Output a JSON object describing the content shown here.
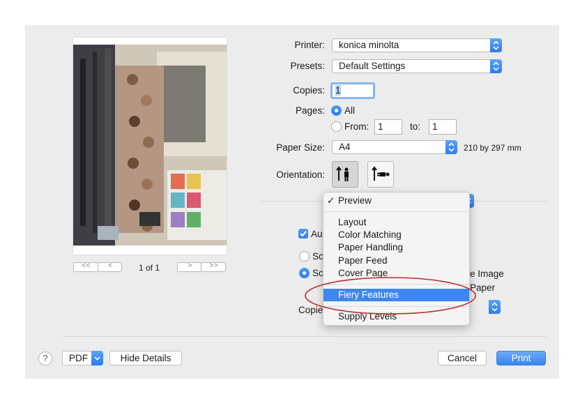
{
  "printer": {
    "label": "Printer:",
    "value": "konica minolta"
  },
  "presets": {
    "label": "Presets:",
    "value": "Default Settings"
  },
  "copies": {
    "label": "Copies:",
    "value": "1"
  },
  "pages": {
    "label": "Pages:",
    "all": "All",
    "from_label": "From:",
    "from_value": "1",
    "to_label": "to:",
    "to_value": "1"
  },
  "paper_size": {
    "label": "Paper Size:",
    "value": "A4",
    "dims": "210 by 297 mm"
  },
  "orientation": {
    "label": "Orientation:"
  },
  "preview": {
    "page_count": "1 of 1"
  },
  "menu": {
    "checked": "✓",
    "items": [
      "Preview",
      "Layout",
      "Color Matching",
      "Paper Handling",
      "Paper Feed",
      "Cover Page",
      "Fiery Features",
      "Supply Levels"
    ],
    "highlighted": "Fiery Features"
  },
  "background_fragments": {
    "auto_rotate": "Au",
    "scale_a": "Sc",
    "scale_b": "Sc",
    "image_text": "e Image",
    "paper_text": "Paper",
    "copies_per": "Copie"
  },
  "footer": {
    "help": "?",
    "pdf": "PDF",
    "hide_details": "Hide Details",
    "cancel": "Cancel",
    "print": "Print"
  },
  "colors": {
    "accent": "#3c87f0",
    "annotation": "#c0282d",
    "dialog_bg": "#ececec"
  }
}
